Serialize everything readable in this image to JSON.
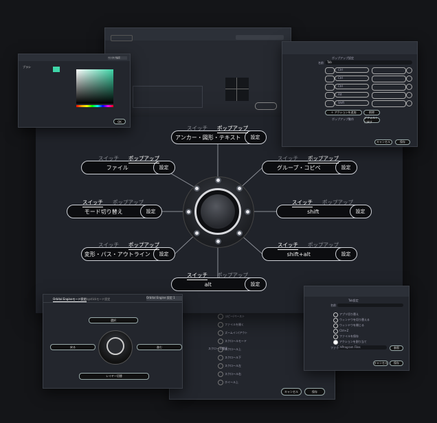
{
  "center": {
    "items": [
      {
        "id": "anchor",
        "label": "アンカー・図形・テキスト",
        "tab_switch": "スイッチ",
        "tab_popup": "ポップアップ",
        "active": "popup",
        "setting": "設定"
      },
      {
        "id": "file",
        "label": "ファイル",
        "tab_switch": "スイッチ",
        "tab_popup": "ポップアップ",
        "active": "popup",
        "setting": "設定"
      },
      {
        "id": "group",
        "label": "グループ・コピペ",
        "tab_switch": "スイッチ",
        "tab_popup": "ポップアップ",
        "active": "popup",
        "setting": "設定"
      },
      {
        "id": "mode",
        "label": "モード切り替え",
        "tab_switch": "スイッチ",
        "tab_popup": "ポップアップ",
        "active": "switch",
        "setting": "設定"
      },
      {
        "id": "shift",
        "label": "shift",
        "tab_switch": "スイッチ",
        "tab_popup": "ポップアップ",
        "active": "switch",
        "setting": "設定"
      },
      {
        "id": "transform",
        "label": "変形・パス・アウトライン",
        "tab_switch": "スイッチ",
        "tab_popup": "ポップアップ",
        "active": "popup",
        "setting": "設定"
      },
      {
        "id": "shiftalt",
        "label": "shift+alt",
        "tab_switch": "スイッチ",
        "tab_popup": "ポップアップ",
        "active": "switch",
        "setting": "設定"
      },
      {
        "id": "alt",
        "label": "alt",
        "tab_switch": "スイッチ",
        "tab_popup": "ポップアップ",
        "active": "switch",
        "setting": "設定"
      }
    ]
  },
  "bottom_left": {
    "tab_1": "Orbital Engineモード設定",
    "tab_2": "Joystickモード設定",
    "dropdown": "Orbital Engine 設定 1",
    "btn_setting": "設定",
    "btn_setting2": "設定",
    "btn_setting3": "設定",
    "top_label": "選択",
    "left_label": "戻る",
    "right_label": "進む",
    "bottom_label": "レイヤー切替",
    "btn_setting4": "設定"
  },
  "bottom_center": {
    "lines": [
      "コピー/ペースト",
      "ファイルを開く",
      "ズームイン/アウト",
      "スクロールモード",
      "スクロール上",
      "スクロール下",
      "スクロール左",
      "スクロール右",
      "ホイール上"
    ],
    "header": "スクロール関連",
    "cancel": "キャンセル",
    "save": "保存"
  },
  "top_right": {
    "title": "ポップアップ設定",
    "name_label": "名前",
    "name_value": "Tab",
    "rows": [
      "Ctrl",
      "Ctrl",
      "Ctrl",
      "Alt",
      "Shift"
    ],
    "add_btn": "＋ アクションを追加",
    "delete_btn": "削除",
    "option_label": "ポップアップ動作",
    "default_btn": "デフォルトに戻す",
    "cancel": "キャンセル",
    "save": "保存"
  },
  "top_left": {
    "dropdown": "ペンタブ設定",
    "item": "ブラシ",
    "ok": "OK"
  },
  "bottom_right": {
    "title": "Tab設定",
    "name_label": "名前",
    "options": [
      "アプリ切り替え",
      "ウィンドウを切り替える",
      "ウィンドウを閉じる",
      "Ctrl+Z",
      "ファイルを保存",
      "アクションを割り当て"
    ],
    "path_label": "ファイル",
    "path_value": "C:¥Program Files",
    "browse": "参照",
    "cancel": "キャンセル",
    "save": "保存"
  },
  "colors": {
    "accent": "#3fd6a8",
    "bg": "#141518",
    "panel": "#23262d"
  }
}
